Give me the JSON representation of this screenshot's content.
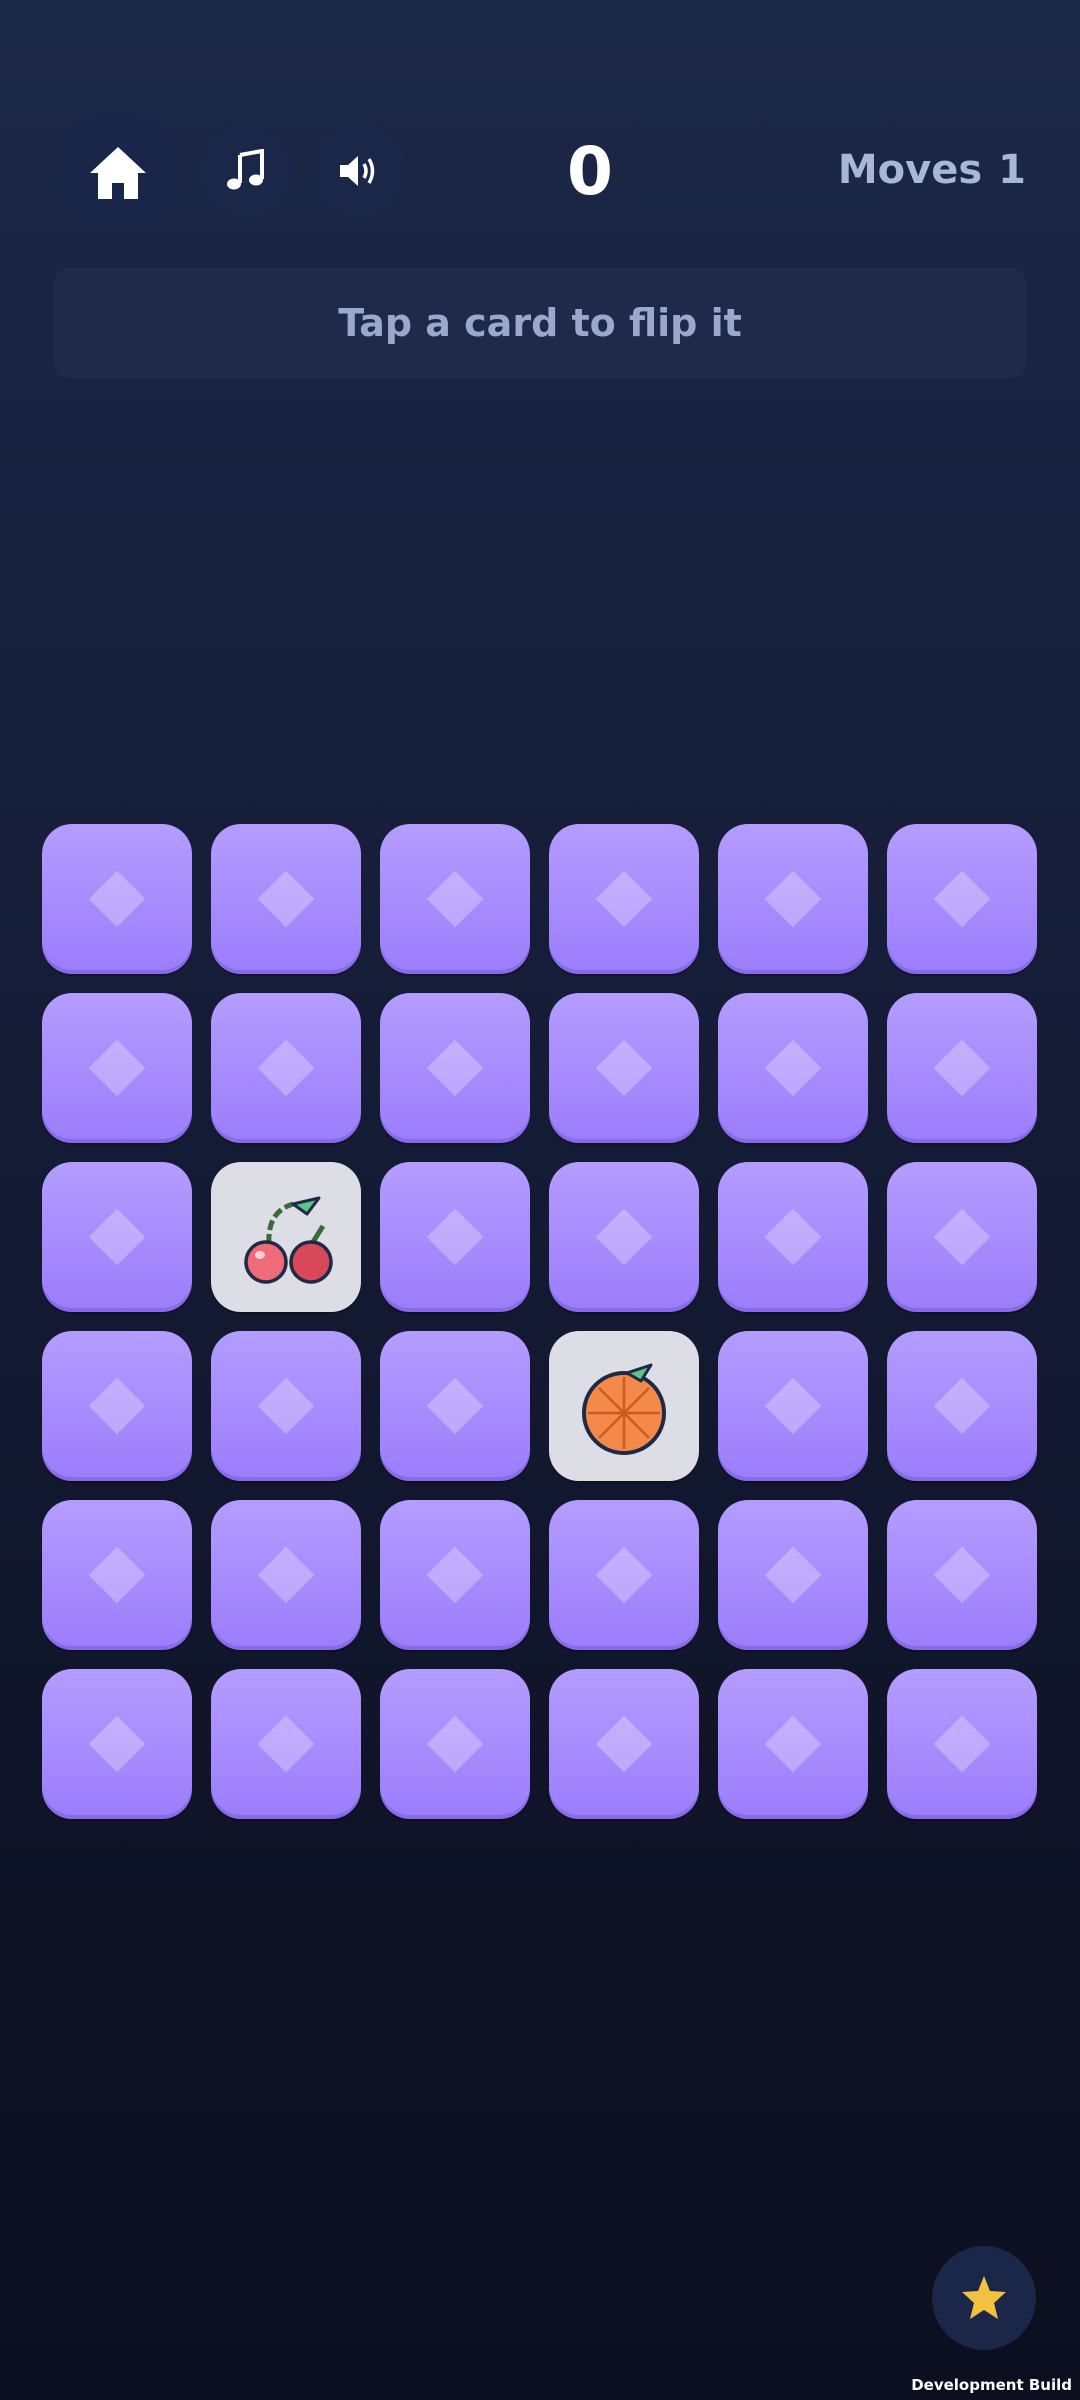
{
  "score": "0",
  "moves": {
    "label": "Moves",
    "value": "1"
  },
  "hint": "Tap a card to flip it",
  "board": {
    "rows": 6,
    "cols": 6,
    "revealed": [
      {
        "row": 3,
        "col": 2,
        "fruit": "cherry"
      },
      {
        "row": 4,
        "col": 4,
        "fruit": "orange"
      }
    ]
  },
  "icons": {
    "home": "home-icon",
    "music": "music-note-icon",
    "sound": "speaker-icon",
    "star": "star-icon",
    "card_back": "diamond-icon"
  },
  "colors": {
    "card_back": "#a48bfd",
    "card_face": "#dddde6",
    "star": "#f4c040",
    "accent_text": "#a9b6d6"
  },
  "footer": "Development Build"
}
